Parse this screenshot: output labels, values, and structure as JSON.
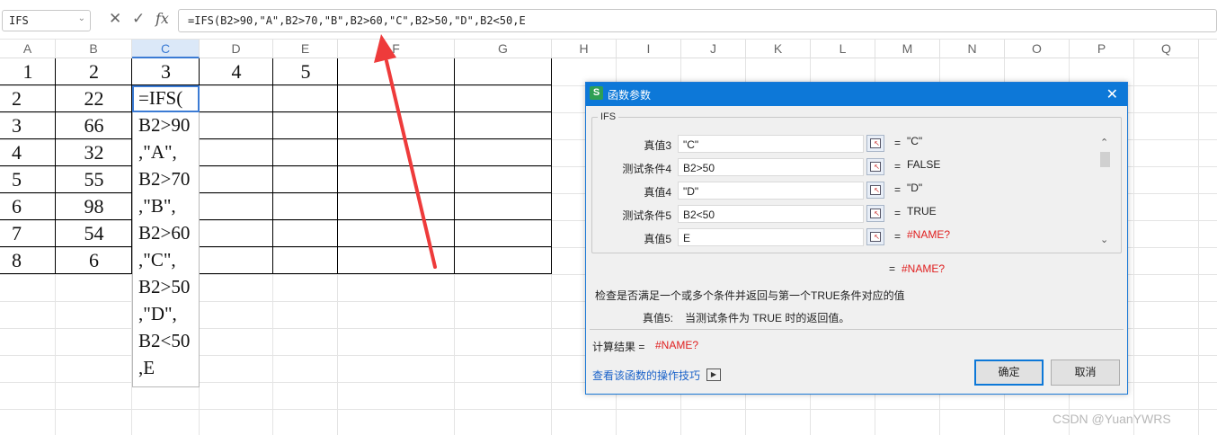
{
  "formula_bar": {
    "name_box": "IFS",
    "cancel_icon": "✕",
    "confirm_icon": "✓",
    "fx_label": "fx",
    "formula": "=IFS(B2>90,\"A\",B2>70,\"B\",B2>60,\"C\",B2>50,\"D\",B2<50,E"
  },
  "columns": [
    "A",
    "B",
    "C",
    "D",
    "E",
    "F",
    "G",
    "H",
    "I",
    "J",
    "K",
    "L",
    "M",
    "N",
    "O",
    "P",
    "Q"
  ],
  "selected_column": "C",
  "sheet": {
    "row1": [
      "1",
      "2",
      "3",
      "4",
      "5"
    ],
    "col_a": [
      "2",
      "3",
      "4",
      "5",
      "6",
      "7",
      "8"
    ],
    "col_b": [
      "22",
      "66",
      "32",
      "55",
      "98",
      "54",
      "6"
    ],
    "c2_lines": [
      "=IFS(",
      "B2>90",
      ",\"A\",",
      "B2>70",
      ",\"B\",",
      "B2>60",
      ",\"C\",",
      "B2>50",
      ",\"D\",",
      "B2<50",
      ",E"
    ]
  },
  "dialog": {
    "title": "函数参数",
    "logo": "S",
    "close_icon": "✕",
    "function_name": "IFS",
    "params": [
      {
        "label": "真值3",
        "value": "\"C\"",
        "result": "\"C\"",
        "error": false
      },
      {
        "label": "测试条件4",
        "value": "B2>50",
        "result": "FALSE",
        "error": false
      },
      {
        "label": "真值4",
        "value": "\"D\"",
        "result": "\"D\"",
        "error": false
      },
      {
        "label": "测试条件5",
        "value": "B2<50",
        "result": "TRUE",
        "error": false
      },
      {
        "label": "真值5",
        "value": "E",
        "result": "#NAME?",
        "error": true
      }
    ],
    "eq": "=",
    "overall_result": "#NAME?",
    "description": "检查是否满足一个或多个条件并返回与第一个TRUE条件对应的值",
    "arg_help_label": "真值5:",
    "arg_help_text": "当测试条件为 TRUE 时的返回值。",
    "calc_label": "计算结果 =",
    "calc_value": "#NAME?",
    "help_link": "查看该函数的操作技巧",
    "ok": "确定",
    "cancel": "取消",
    "error_color": "#e02020"
  },
  "watermark": "CSDN @YuanYWRS"
}
